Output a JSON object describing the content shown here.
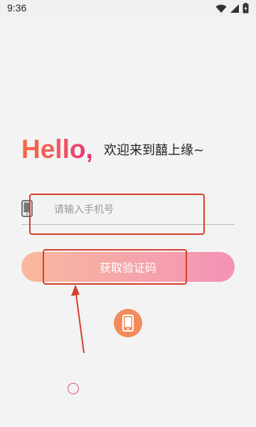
{
  "status_bar": {
    "time": "9:36",
    "icons": [
      "wifi-icon",
      "signal-icon",
      "battery-icon"
    ]
  },
  "hero": {
    "hello": "Hello,",
    "welcome": "欢迎来到囍上缘~"
  },
  "login": {
    "phone_placeholder": "请输入手机号",
    "phone_value": "",
    "phone_icon": "mobile-phone-icon",
    "get_code_label": "获取验证码",
    "alt_login_icon": "mobile-phone-icon"
  },
  "colors": {
    "hello_gradient_start": "#f66a3f",
    "hello_gradient_end": "#e2326f",
    "button_gradient_start": "#f8b89e",
    "button_gradient_end": "#f392b6",
    "alt_login_bg": "#f28c5d",
    "annotation": "#d4402a"
  }
}
